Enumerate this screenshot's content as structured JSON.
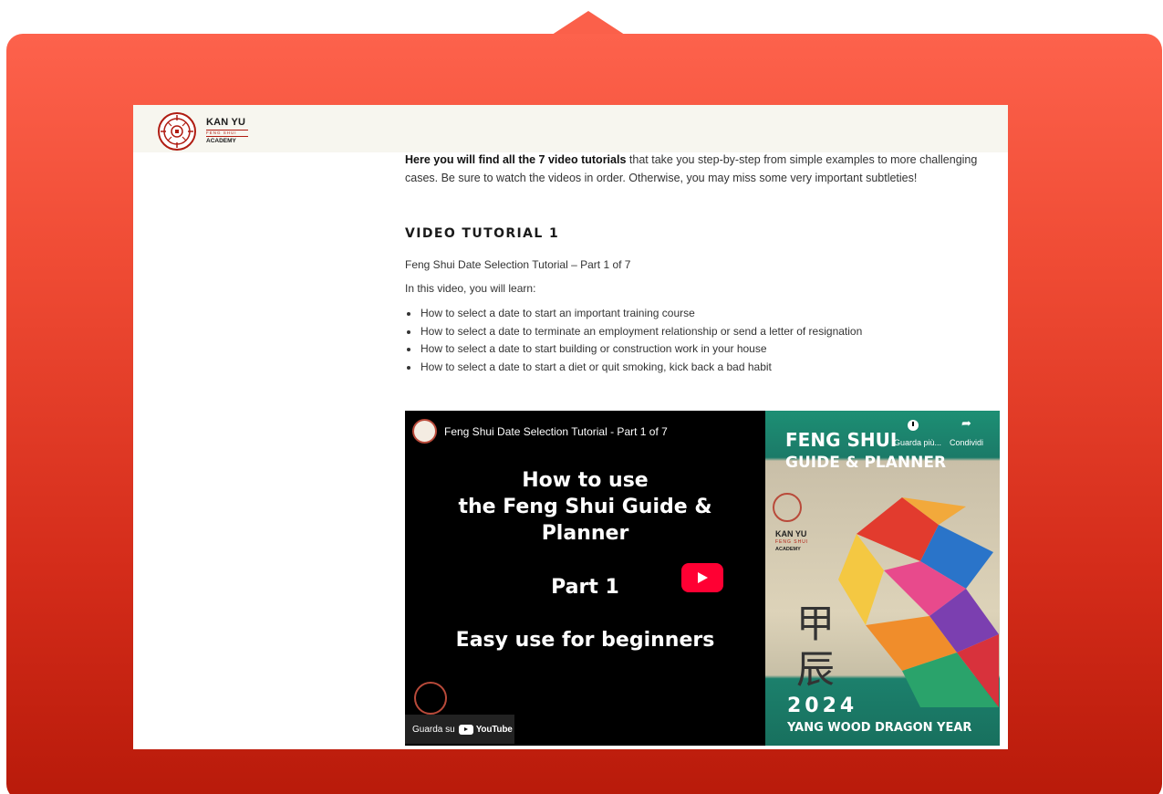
{
  "header": {
    "logo_line1": "KAN YU",
    "logo_line2": "FENG SHUI",
    "logo_line3": "ACADEMY"
  },
  "content": {
    "intro_bold": "Here you will find all the 7 video tutorials",
    "intro_rest": " that take you step-by-step from simple examples to more challenging cases. Be sure to watch the videos in order. Otherwise, you may miss some very important subtleties!",
    "section_title": "VIDEO TUTORIAL 1",
    "subtitle": "Feng Shui Date Selection Tutorial – Part 1 of 7",
    "learn_intro": "In this video, you will learn:",
    "bullets": [
      "How to select a date to start an important training course",
      "How to select a date to terminate an employment relationship or send a letter of resignation",
      "How to select a date to start building or construction work in your house",
      "How to select a date to start a diet or quit smoking, kick back a bad habit"
    ]
  },
  "video": {
    "title": "Feng Shui Date Selection Tutorial - Part 1 of 7",
    "watch_later_label": "Guarda più...",
    "share_label": "Condividi",
    "thumb_lines": [
      "How to use",
      "the Feng Shui Guide &",
      "Planner",
      "Part 1",
      "Easy use for beginners"
    ],
    "poster_title1": "FENG SHUI",
    "poster_title2": "GUIDE & PLANNER",
    "poster_kan": "KAN YU",
    "poster_feng": "FENG SHUI",
    "poster_academy": "ACADEMY",
    "poster_kanji1": "甲",
    "poster_kanji2": "辰",
    "poster_year": "2024",
    "poster_sub": "YANG WOOD DRAGON YEAR",
    "watch_on": "Guarda su",
    "youtube": "YouTube"
  },
  "colors": {
    "frame_top": "#fd624c",
    "frame_bottom": "#b81a0a",
    "header_bg": "#f7f6ef",
    "youtube_red": "#ff0033",
    "poster_green": "#1b7a68"
  }
}
